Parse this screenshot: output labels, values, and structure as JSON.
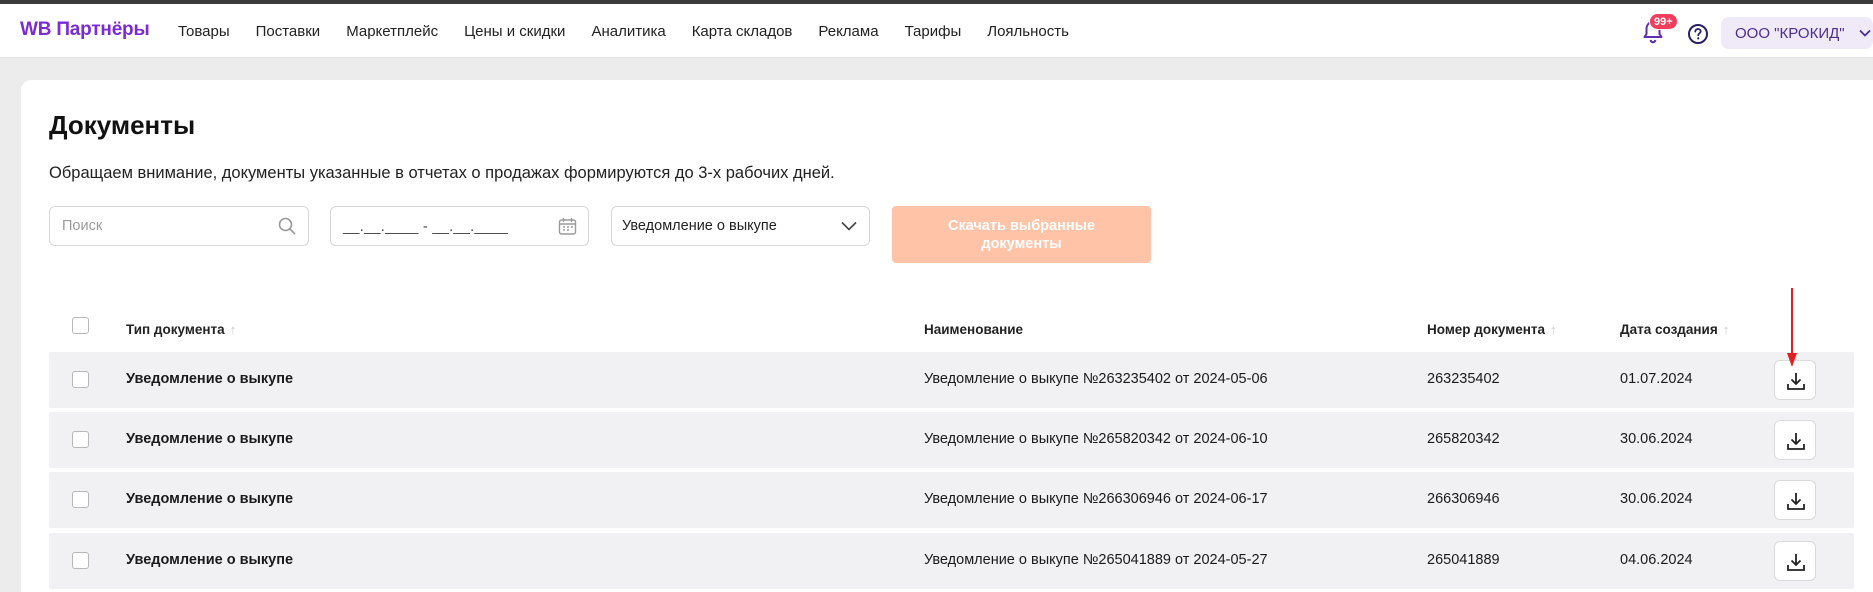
{
  "header": {
    "logo": "WB Партнёры",
    "nav": [
      "Товары",
      "Поставки",
      "Маркетплейс",
      "Цены и скидки",
      "Аналитика",
      "Карта складов",
      "Реклама",
      "Тарифы",
      "Лояльность"
    ],
    "notifications_badge": "99+",
    "organization": "ООО \"КРОКИД\""
  },
  "page": {
    "title": "Документы",
    "notice": "Обращаем внимание, документы указанные в отчетах о продажах формируются до 3-х рабочих дней."
  },
  "filters": {
    "search_placeholder": "Поиск",
    "date_placeholder": "__.__.____ - __.__.____",
    "doc_type_selected": "Уведомление о выкупе",
    "download_selected_label_line1": "Скачать выбранные",
    "download_selected_label_line2": "документы"
  },
  "table": {
    "columns": {
      "type": "Тип документа",
      "name": "Наименование",
      "number": "Номер документа",
      "date": "Дата создания"
    },
    "sort_arrow": "↑",
    "rows": [
      {
        "type": "Уведомление о выкупе",
        "name": "Уведомление о выкупе №263235402 от 2024-05-06",
        "number": "263235402",
        "date": "01.07.2024"
      },
      {
        "type": "Уведомление о выкупе",
        "name": "Уведомление о выкупе №265820342 от 2024-06-10",
        "number": "265820342",
        "date": "30.06.2024"
      },
      {
        "type": "Уведомление о выкупе",
        "name": "Уведомление о выкупе №266306946 от 2024-06-17",
        "number": "266306946",
        "date": "30.06.2024"
      },
      {
        "type": "Уведомление о выкупе",
        "name": "Уведомление о выкупе №265041889 от 2024-05-27",
        "number": "265041889",
        "date": "04.06.2024"
      }
    ]
  },
  "colors": {
    "brand": "#7b2bd6",
    "download_button_disabled": "#ffc4a8",
    "badge": "#f23d5b",
    "annotation_arrow": "#e02020"
  }
}
